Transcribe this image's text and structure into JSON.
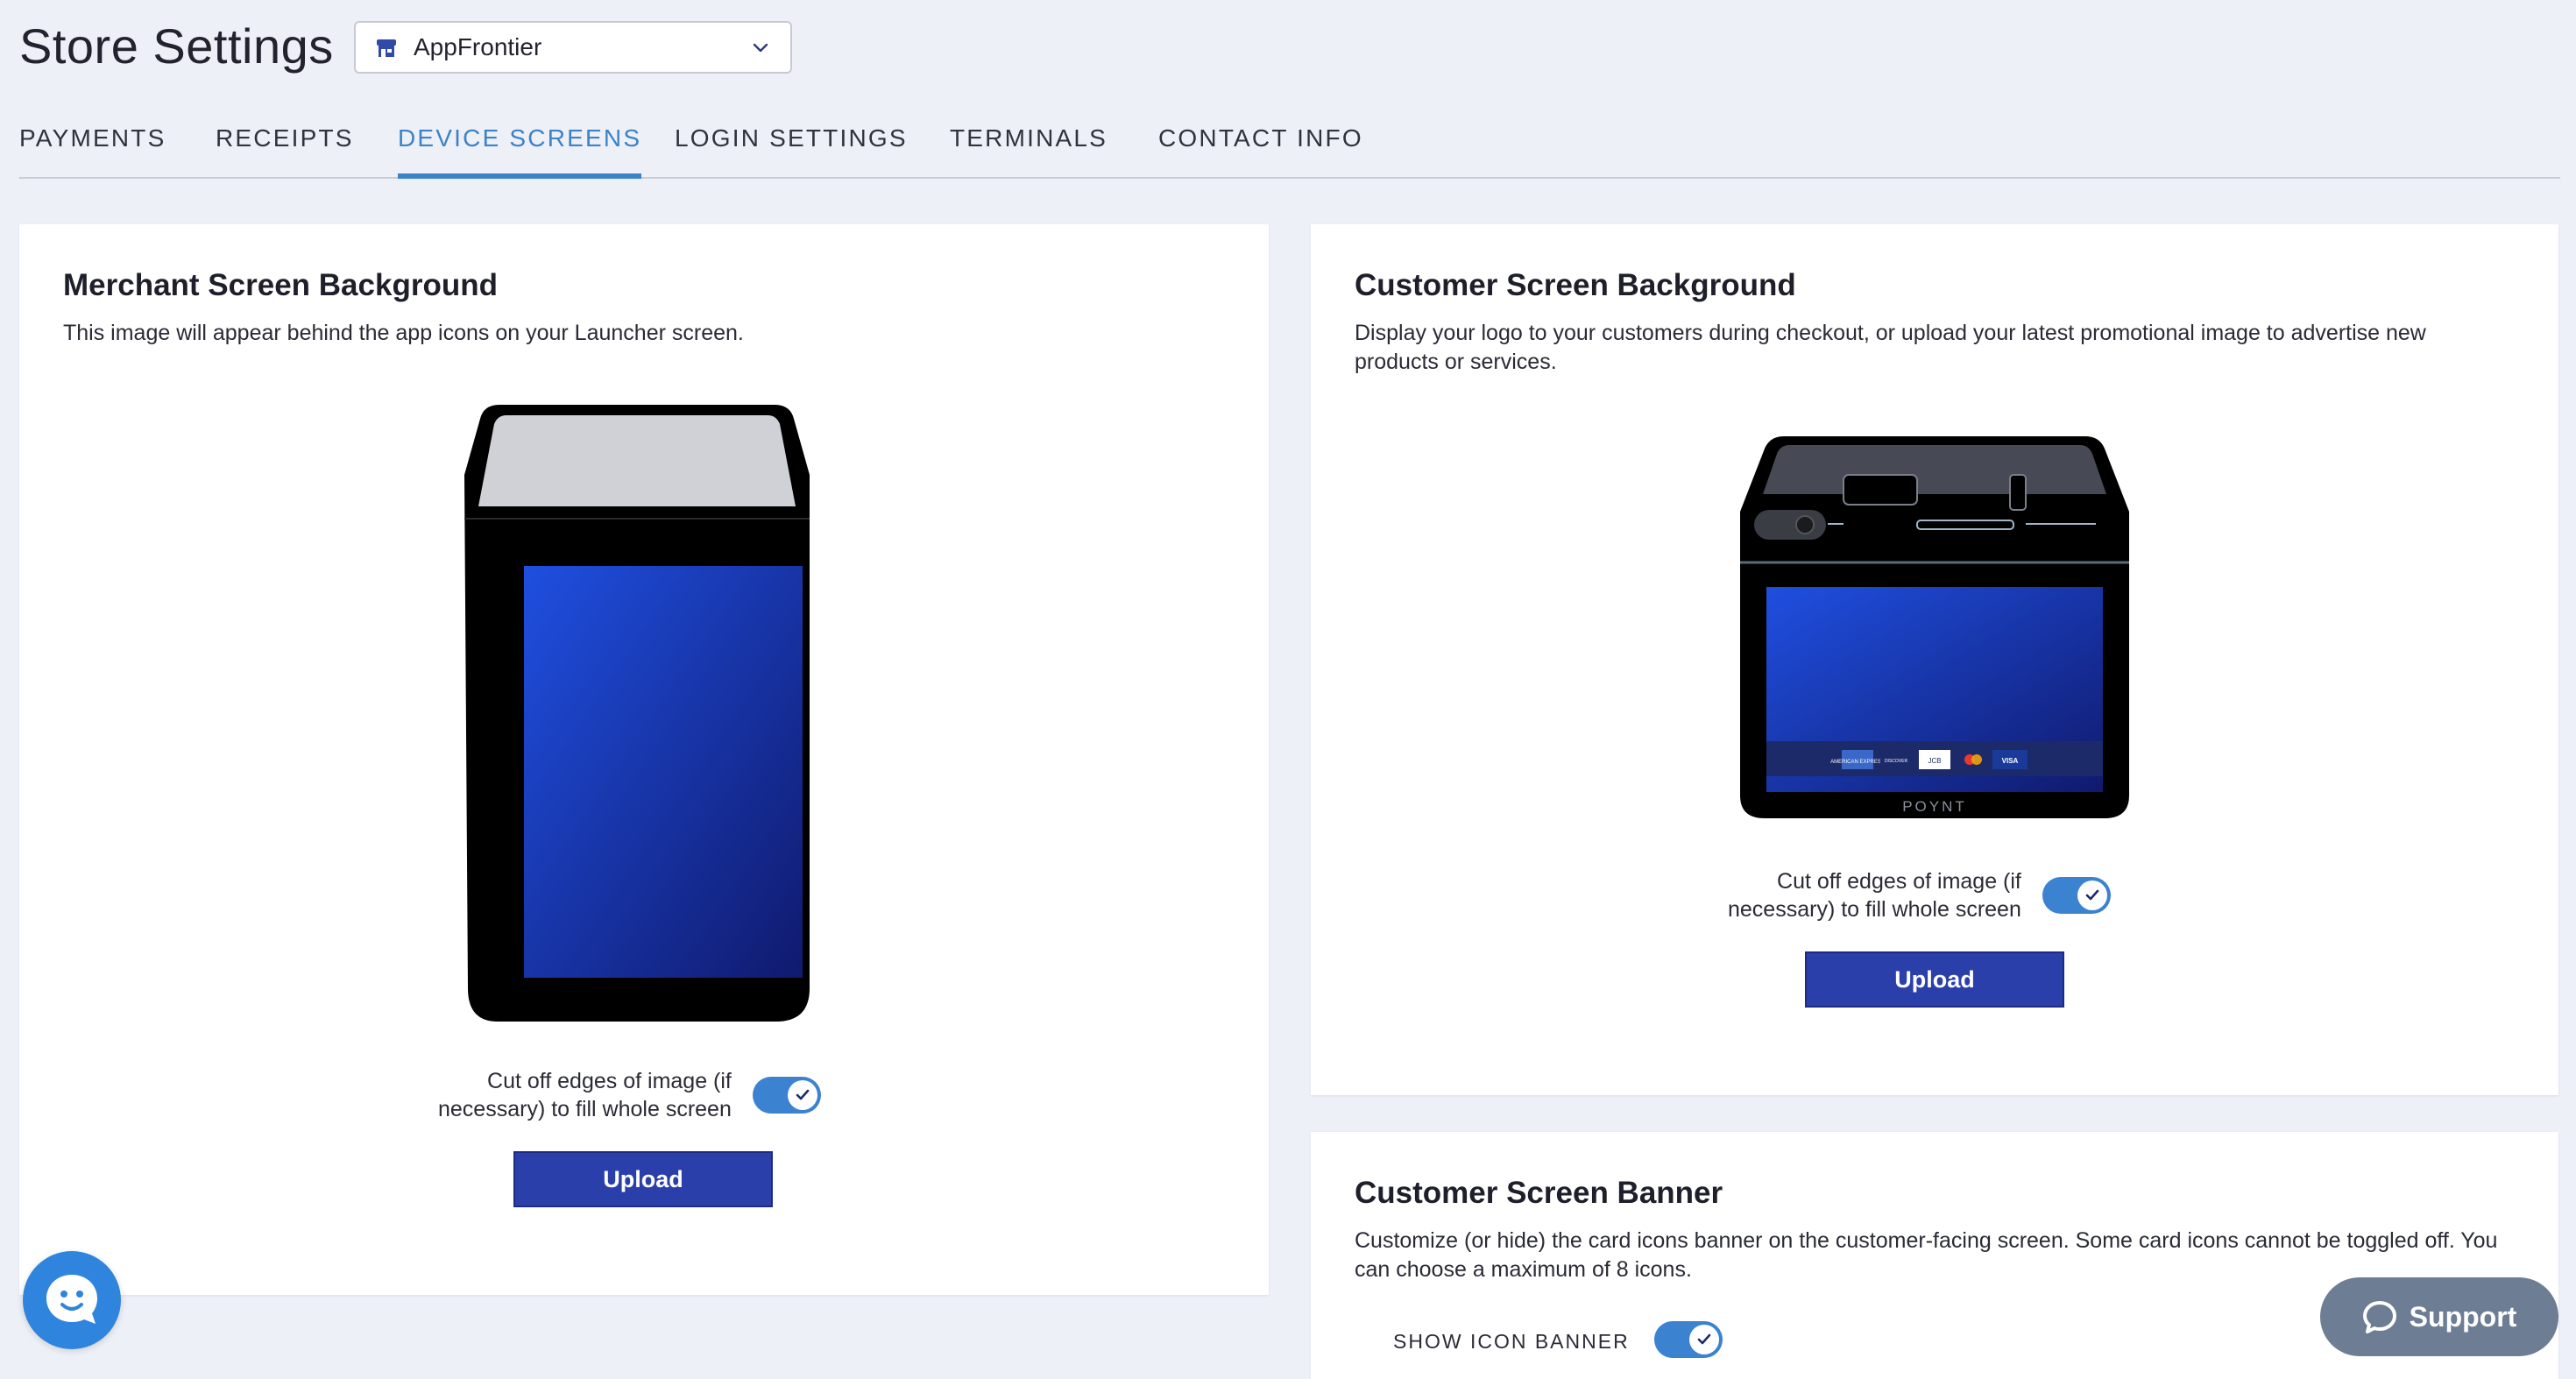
{
  "page": {
    "title": "Store Settings",
    "store_selector": {
      "value": "AppFrontier"
    }
  },
  "tabs": [
    {
      "label": "PAYMENTS",
      "active": false
    },
    {
      "label": "RECEIPTS",
      "active": false
    },
    {
      "label": "DEVICE SCREENS",
      "active": true
    },
    {
      "label": "LOGIN SETTINGS",
      "active": false
    },
    {
      "label": "TERMINALS",
      "active": false
    },
    {
      "label": "CONTACT INFO",
      "active": false
    }
  ],
  "merchant": {
    "title": "Merchant Screen Background",
    "description": "This image will appear behind the app icons on your Launcher screen.",
    "toggle_label_line1": "Cut off edges of image (if",
    "toggle_label_line2": "necessary) to fill whole screen",
    "toggle_on": true,
    "upload_label": "Upload"
  },
  "customer": {
    "title": "Customer Screen Background",
    "description": "Display your logo to your customers during checkout, or upload your latest promotional image to advertise new products or services.",
    "toggle_label_line1": "Cut off edges of image (if",
    "toggle_label_line2": "necessary) to fill whole screen",
    "toggle_on": true,
    "upload_label": "Upload",
    "device_brand": "POYNT",
    "card_icons": [
      "AMERICAN EXPRESS",
      "DISCOVER",
      "JCB",
      "MASTERCARD",
      "VISA"
    ]
  },
  "banner": {
    "title": "Customer Screen Banner",
    "description": "Customize (or hide) the card icons banner on the customer-facing screen. Some card icons cannot be toggled off. You can choose a maximum of 8 icons.",
    "show_label": "SHOW ICON BANNER",
    "show_on": true
  },
  "support": {
    "label": "Support"
  },
  "colors": {
    "accent": "#3b82c8",
    "upload_button": "#2a3faa",
    "toggle_on": "#3b82d0",
    "background": "#eef0f8"
  }
}
